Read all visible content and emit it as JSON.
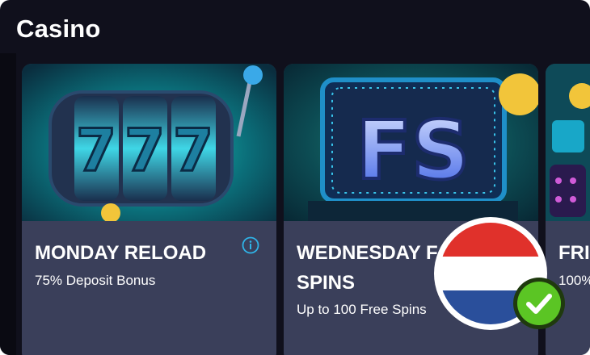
{
  "header": {
    "title": "Casino"
  },
  "cards": [
    {
      "title": "MONDAY RELOAD",
      "subtitle": "75% Deposit Bonus",
      "image_text": "777",
      "icon": "info-icon"
    },
    {
      "title": "WEDNESDAY F… SPINS",
      "title_line1": "WEDNESDAY F",
      "title_line2": "SPINS",
      "subtitle": "Up to 100 Free Spins",
      "image_text": "FS"
    },
    {
      "title": "FRI",
      "subtitle": "100%",
      "image_text": ""
    }
  ],
  "badge": {
    "flag": "netherlands-flag",
    "status": "check-icon",
    "colors": [
      "#e0312b",
      "#ffffff",
      "#2a4f9b"
    ],
    "check_color": "#5bc524"
  },
  "colors": {
    "background": "#10101c",
    "card": "#3a3f5a",
    "accent": "#2fb4e8"
  }
}
